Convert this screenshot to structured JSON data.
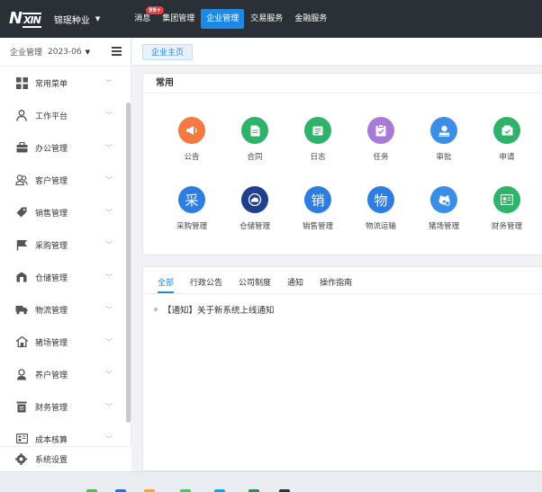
{
  "topbar": {
    "logo_text": "Nxin",
    "company": "锦珉种业",
    "nav": [
      {
        "label": "消息",
        "badge": "99+",
        "active": false
      },
      {
        "label": "集团管理",
        "active": false
      },
      {
        "label": "企业管理",
        "active": true
      },
      {
        "label": "交易服务",
        "active": false
      },
      {
        "label": "金融服务",
        "active": false
      }
    ]
  },
  "sidebar": {
    "header_label": "企业管理",
    "period": "2023-06",
    "items": [
      {
        "label": "常用菜单",
        "icon": "grid-icon"
      },
      {
        "label": "工作平台",
        "icon": "person-icon"
      },
      {
        "label": "办公管理",
        "icon": "briefcase-icon"
      },
      {
        "label": "客户管理",
        "icon": "users-icon"
      },
      {
        "label": "销售管理",
        "icon": "tag-icon"
      },
      {
        "label": "采购管理",
        "icon": "flag-icon"
      },
      {
        "label": "仓储管理",
        "icon": "warehouse-icon"
      },
      {
        "label": "物流管理",
        "icon": "truck-icon"
      },
      {
        "label": "猪场管理",
        "icon": "farm-icon"
      },
      {
        "label": "养户管理",
        "icon": "farmer-icon"
      },
      {
        "label": "财务管理",
        "icon": "ledger-icon"
      },
      {
        "label": "成本核算",
        "icon": "calculator-icon"
      }
    ],
    "footer_label": "系统设置"
  },
  "tabs": {
    "home": "企业主页"
  },
  "common": {
    "title": "常用",
    "apps": [
      {
        "label": "公告",
        "icon": "megaphone-icon",
        "color": "#f47a42"
      },
      {
        "label": "合同",
        "icon": "contract-icon",
        "color": "#2fb36b"
      },
      {
        "label": "日志",
        "icon": "log-icon",
        "color": "#2fb36b"
      },
      {
        "label": "任务",
        "icon": "clipboard-icon",
        "color": "#a77ad9"
      },
      {
        "label": "审批",
        "icon": "approval-icon",
        "color": "#3a8ee6"
      },
      {
        "label": "申请",
        "icon": "application-icon",
        "color": "#2fb36b"
      },
      {
        "label": "采购管理",
        "icon": "purchase-icon",
        "glyph": "采",
        "color": "#2f7de1"
      },
      {
        "label": "仓储管理",
        "icon": "cloud-icon",
        "color": "#1f3f8f"
      },
      {
        "label": "销售管理",
        "icon": "sales-icon",
        "glyph": "销",
        "color": "#2f7de1"
      },
      {
        "label": "物流运输",
        "icon": "logistics-icon",
        "glyph": "物",
        "color": "#2f7de1"
      },
      {
        "label": "猪场管理",
        "icon": "pig-icon",
        "color": "#3a8ee6"
      },
      {
        "label": "财务管理",
        "icon": "finance-icon",
        "color": "#2fb36b"
      }
    ]
  },
  "notices": {
    "tabs": [
      {
        "label": "全部",
        "active": true
      },
      {
        "label": "行政公告",
        "active": false
      },
      {
        "label": "公司制度",
        "active": false
      },
      {
        "label": "通知",
        "active": false
      },
      {
        "label": "操作指南",
        "active": false
      }
    ],
    "items": [
      "【通知】关于新系统上线通知"
    ]
  }
}
